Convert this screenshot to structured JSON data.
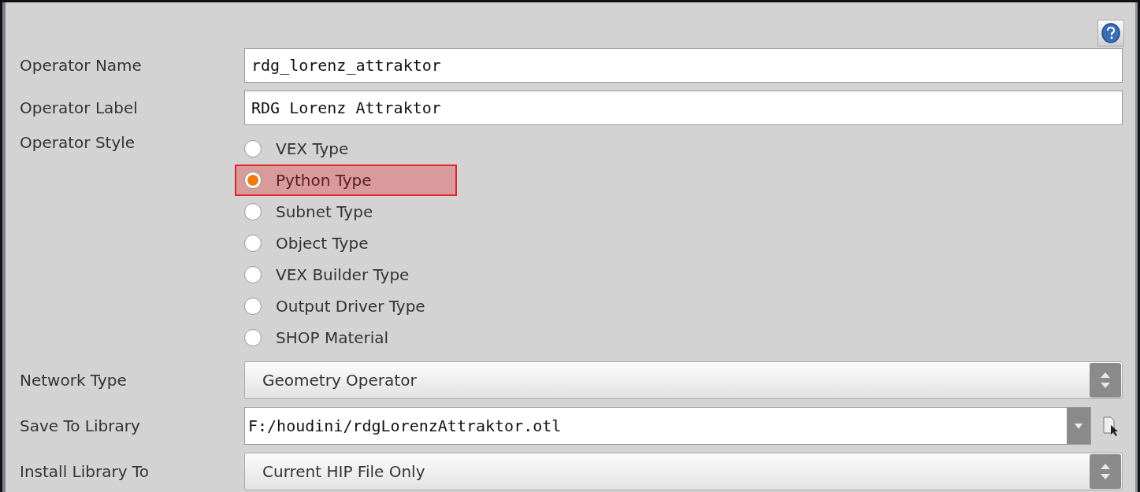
{
  "fields": [
    {
      "label": "Operator Name",
      "value": "rdg_lorenz_attraktor"
    },
    {
      "label": "Operator Label",
      "value": "RDG Lorenz Attraktor"
    }
  ],
  "operator_style": {
    "label": "Operator Style",
    "options": [
      {
        "label": "VEX Type",
        "selected": false,
        "highlighted": false
      },
      {
        "label": "Python Type",
        "selected": true,
        "highlighted": true
      },
      {
        "label": "Subnet Type",
        "selected": false,
        "highlighted": false
      },
      {
        "label": "Object Type",
        "selected": false,
        "highlighted": false
      },
      {
        "label": "VEX Builder Type",
        "selected": false,
        "highlighted": false
      },
      {
        "label": "Output Driver Type",
        "selected": false,
        "highlighted": false
      },
      {
        "label": "SHOP Material",
        "selected": false,
        "highlighted": false
      }
    ]
  },
  "network_type": {
    "label": "Network Type",
    "value": "Geometry Operator"
  },
  "save_to_library": {
    "label": "Save To Library",
    "value": "F:/houdini/rdgLorenzAttraktor.otl"
  },
  "install_library_to": {
    "label": "Install Library To",
    "value": "Current HIP File Only"
  }
}
